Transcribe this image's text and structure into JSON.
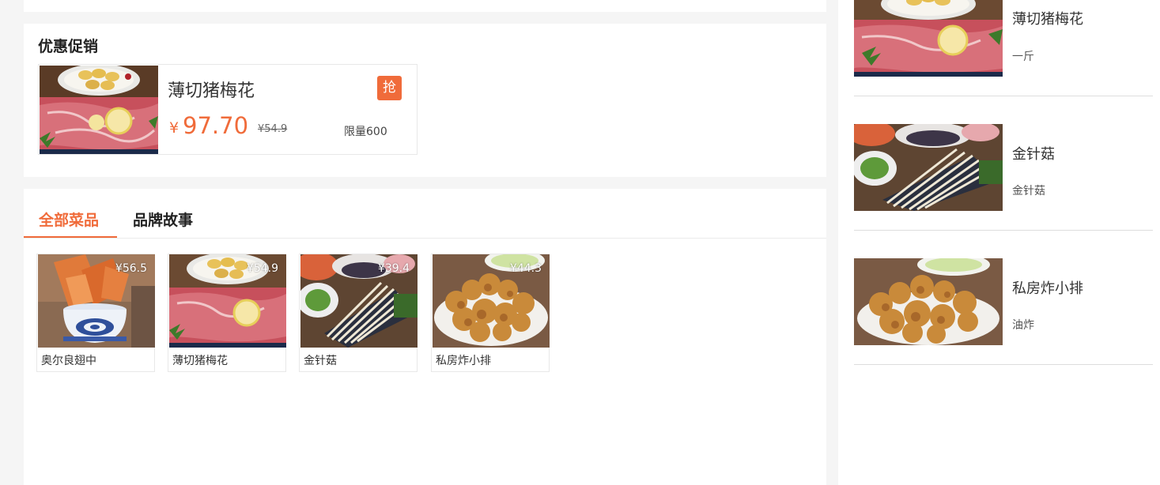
{
  "promo": {
    "title": "优惠促销",
    "item": {
      "name": "薄切猪梅花",
      "grab_label": "抢",
      "currency": "¥",
      "price": "97.70",
      "original_price": "¥54.9",
      "limit": "限量600"
    }
  },
  "tabs": [
    {
      "label": "全部菜品",
      "active": true
    },
    {
      "label": "品牌故事",
      "active": false
    }
  ],
  "dishes": [
    {
      "name": "奥尔良翅中",
      "price": "¥56.5",
      "image": "fried-chicken-wings-photo"
    },
    {
      "name": "薄切猪梅花",
      "price": "¥54.9",
      "image": "sliced-pork-photo"
    },
    {
      "name": "金针菇",
      "price": "¥39.4",
      "image": "enoki-mushroom-photo"
    },
    {
      "name": "私房炸小排",
      "price": "¥44.3",
      "image": "fried-ribs-photo"
    }
  ],
  "right_list": [
    {
      "name": "薄切猪梅花",
      "desc": "一斤",
      "image": "sliced-pork-photo"
    },
    {
      "name": "金针菇",
      "desc": "金针菇",
      "image": "enoki-mushroom-photo"
    },
    {
      "name": "私房炸小排",
      "desc": "油炸",
      "image": "fried-ribs-photo"
    }
  ],
  "colors": {
    "accent": "#f06b3a",
    "background": "#f5f5f5",
    "card": "#ffffff"
  }
}
